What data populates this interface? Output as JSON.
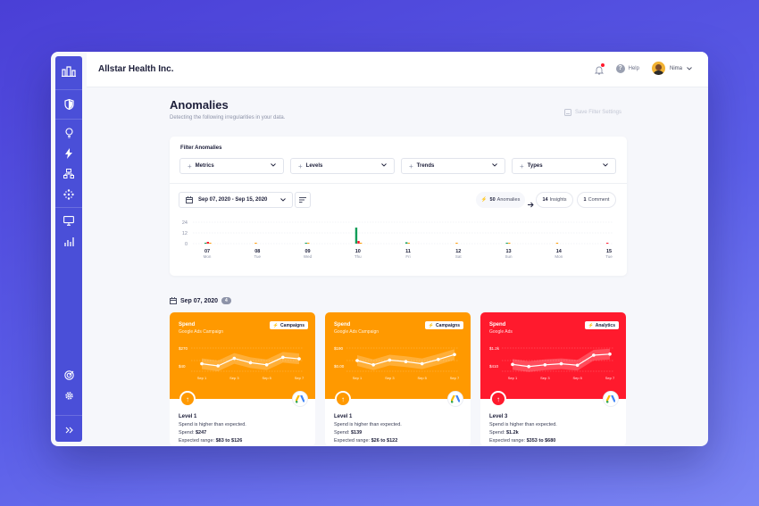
{
  "colors": {
    "brand_sidebar": "#4a4fd8",
    "orange": "#ff9900",
    "red": "#ff1a2d",
    "green": "#0f9d58"
  },
  "sidebar": {
    "icons": [
      "building-chart-icon",
      "shield-icon",
      "lightbulb-icon",
      "bolt-icon",
      "org-chart-icon",
      "nodes-icon",
      "monitor-icon",
      "bar-chart-icon",
      "target-icon",
      "settings-icon",
      "double-chevron-right-icon"
    ]
  },
  "header": {
    "company": "Allstar Health Inc.",
    "help_label": "Help",
    "help_glyph": "?",
    "user_name": "Nima"
  },
  "page": {
    "title": "Anomalies",
    "subtitle": "Detecting the following irregularities in your data.",
    "save_filter_label": "Save Filter Settings"
  },
  "filters": {
    "title": "Filter Anomalies",
    "dropdowns": [
      "Metrics",
      "Levels",
      "Trends",
      "Types"
    ]
  },
  "timeline": {
    "date_range": "Sep 07, 2020 - Sep 15, 2020",
    "anomalies_count": "50",
    "anomalies_label": "Anomalies",
    "insights_count": "14",
    "insights_label": "Insights",
    "comment_count": "1",
    "comment_label": "Comment"
  },
  "chart_data": {
    "type": "bar",
    "y_ticks": [
      "24",
      "12",
      "0"
    ],
    "ylim": [
      0,
      24
    ],
    "categories": [
      {
        "day": "07",
        "weekday": "Mon"
      },
      {
        "day": "08",
        "weekday": "Tue"
      },
      {
        "day": "09",
        "weekday": "Wed"
      },
      {
        "day": "10",
        "weekday": "Thu"
      },
      {
        "day": "11",
        "weekday": "Fri"
      },
      {
        "day": "12",
        "weekday": "Sat"
      },
      {
        "day": "13",
        "weekday": "Sun"
      },
      {
        "day": "14",
        "weekday": "Mon"
      },
      {
        "day": "15",
        "weekday": "Tue"
      }
    ],
    "series": [
      {
        "color": "#0f9d58",
        "values": [
          1,
          0,
          1,
          18,
          1.5,
          0,
          1,
          0,
          0
        ]
      },
      {
        "color": "#ff1a2d",
        "values": [
          2,
          0,
          0,
          3,
          0,
          0,
          0,
          0,
          1
        ]
      },
      {
        "color": "#ff9900",
        "values": [
          1,
          1,
          1,
          1,
          1,
          1,
          1,
          1,
          0
        ]
      }
    ]
  },
  "day_section": {
    "date": "Sep 07, 2020",
    "count": "4"
  },
  "cards": [
    {
      "title": "Spend",
      "subtitle": "Google Ads Campaign",
      "tag": "Campaigns",
      "color": "#ff9900",
      "y_labels": [
        "$270",
        "$40"
      ],
      "x_labels": [
        "Sep 1",
        "Sep 3",
        "Sep 5",
        "Sep 7"
      ],
      "line": [
        0.35,
        0.25,
        0.6,
        0.4,
        0.3,
        0.65,
        0.58
      ],
      "level": "Level 1",
      "desc": "Spend is higher than expected.",
      "spend_label": "Spend:",
      "spend_value": "$247",
      "expected_label": "Expected range:",
      "expected_value": "$83 to $126"
    },
    {
      "title": "Spend",
      "subtitle": "Google Ads Campaign",
      "tag": "Campaigns",
      "color": "#ff9900",
      "y_labels": [
        "$190",
        "$0.00"
      ],
      "x_labels": [
        "Sep 1",
        "Sep 3",
        "Sep 5",
        "Sep 7"
      ],
      "line": [
        0.5,
        0.3,
        0.52,
        0.45,
        0.35,
        0.55,
        0.78
      ],
      "level": "Level 1",
      "desc": "Spend is higher than expected.",
      "spend_label": "Spend:",
      "spend_value": "$139",
      "expected_label": "Expected range:",
      "expected_value": "$26 to $122"
    },
    {
      "title": "Spend",
      "subtitle": "Google Ads",
      "tag": "Analytics",
      "color": "#ff1a2d",
      "y_labels": [
        "$1.2k",
        "$410"
      ],
      "x_labels": [
        "Sep 1",
        "Sep 3",
        "Sep 5",
        "Sep 7"
      ],
      "line": [
        0.32,
        0.22,
        0.3,
        0.35,
        0.28,
        0.75,
        0.8
      ],
      "level": "Level 3",
      "desc": "Spend is higher than expected.",
      "spend_label": "Spend:",
      "spend_value": "$1.2k",
      "expected_label": "Expected range:",
      "expected_value": "$353 to $680"
    }
  ]
}
